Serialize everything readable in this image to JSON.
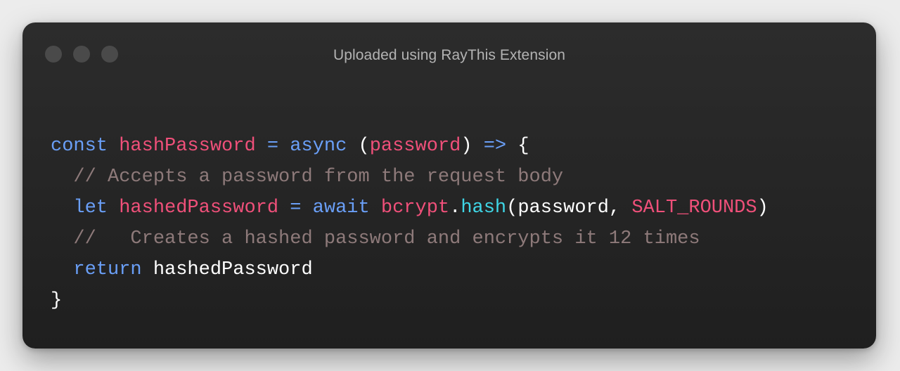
{
  "window": {
    "title": "Uploaded using RayThis Extension",
    "buttons": [
      "close",
      "minimize",
      "zoom"
    ]
  },
  "code": {
    "line1": {
      "kw_const": "const",
      "id_name": "hashPassword",
      "op_eq": "=",
      "kw_async": "async",
      "paren_open": "(",
      "param": "password",
      "paren_close": ")",
      "op_arrow": "=>",
      "brace_open": "{"
    },
    "line2": {
      "comment": "// Accepts a password from the request body"
    },
    "line3": {
      "kw_let": "let",
      "id_var": "hashedPassword",
      "op_eq": "=",
      "kw_await": "await",
      "obj": "bcrypt",
      "dot": ".",
      "method": "hash",
      "args_open": "(password, ",
      "const_arg": "SALT_ROUNDS",
      "args_close": ")"
    },
    "line4": {
      "comment": "//   Creates a hashed password and encrypts it 12 times"
    },
    "line5": {
      "kw_return": "return",
      "value": "hashedPassword"
    },
    "line6": {
      "brace_close": "}"
    }
  },
  "colors": {
    "keyword": "#6a9ff7",
    "identifier": "#f0507a",
    "comment": "#8e7a7a",
    "method": "#3fd6e6",
    "plain": "#ffffff",
    "window_bg": "#262626",
    "page_bg": "#ececec"
  }
}
